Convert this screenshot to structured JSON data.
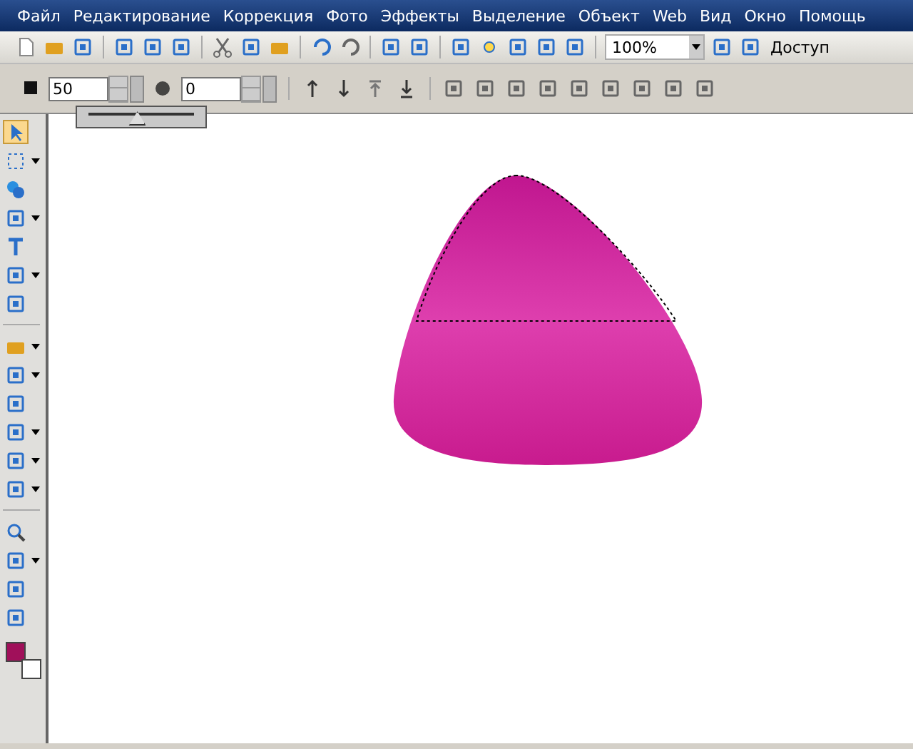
{
  "menu_bar": {
    "items": [
      "Файл",
      "Редактирование",
      "Коррекция",
      "Фото",
      "Эффекты",
      "Выделение",
      "Объект",
      "Web",
      "Вид",
      "Окно",
      "Помощь"
    ]
  },
  "standard_toolbar": {
    "zoom": {
      "value": "100%"
    },
    "share_button": "Доступ"
  },
  "attribute_toolbar": {
    "first_field": {
      "value": "50"
    },
    "second_field": {
      "value": "0"
    },
    "slider": {
      "level": 0.45
    }
  },
  "tools": [
    {
      "selected": true,
      "has_menu": false
    },
    {
      "selected": false,
      "has_menu": true
    },
    {
      "selected": false,
      "has_menu": false
    },
    {
      "selected": false,
      "has_menu": true
    },
    {
      "selected": false,
      "has_menu": false
    },
    {
      "selected": false,
      "has_menu": true
    },
    {
      "selected": false,
      "has_menu": false
    },
    {
      "selected": false,
      "has_menu": true
    },
    {
      "selected": false,
      "has_menu": true
    },
    {
      "selected": false,
      "has_menu": false
    },
    {
      "selected": false,
      "has_menu": true
    },
    {
      "selected": false,
      "has_menu": true
    },
    {
      "selected": false,
      "has_menu": true
    },
    {
      "selected": false,
      "has_menu": false
    },
    {
      "selected": false,
      "has_menu": true
    },
    {
      "selected": false,
      "has_menu": false
    },
    {
      "selected": false,
      "has_menu": false
    }
  ],
  "swatches": [
    {
      "color": "#a0105a"
    },
    {
      "color": "#ffffff"
    }
  ]
}
